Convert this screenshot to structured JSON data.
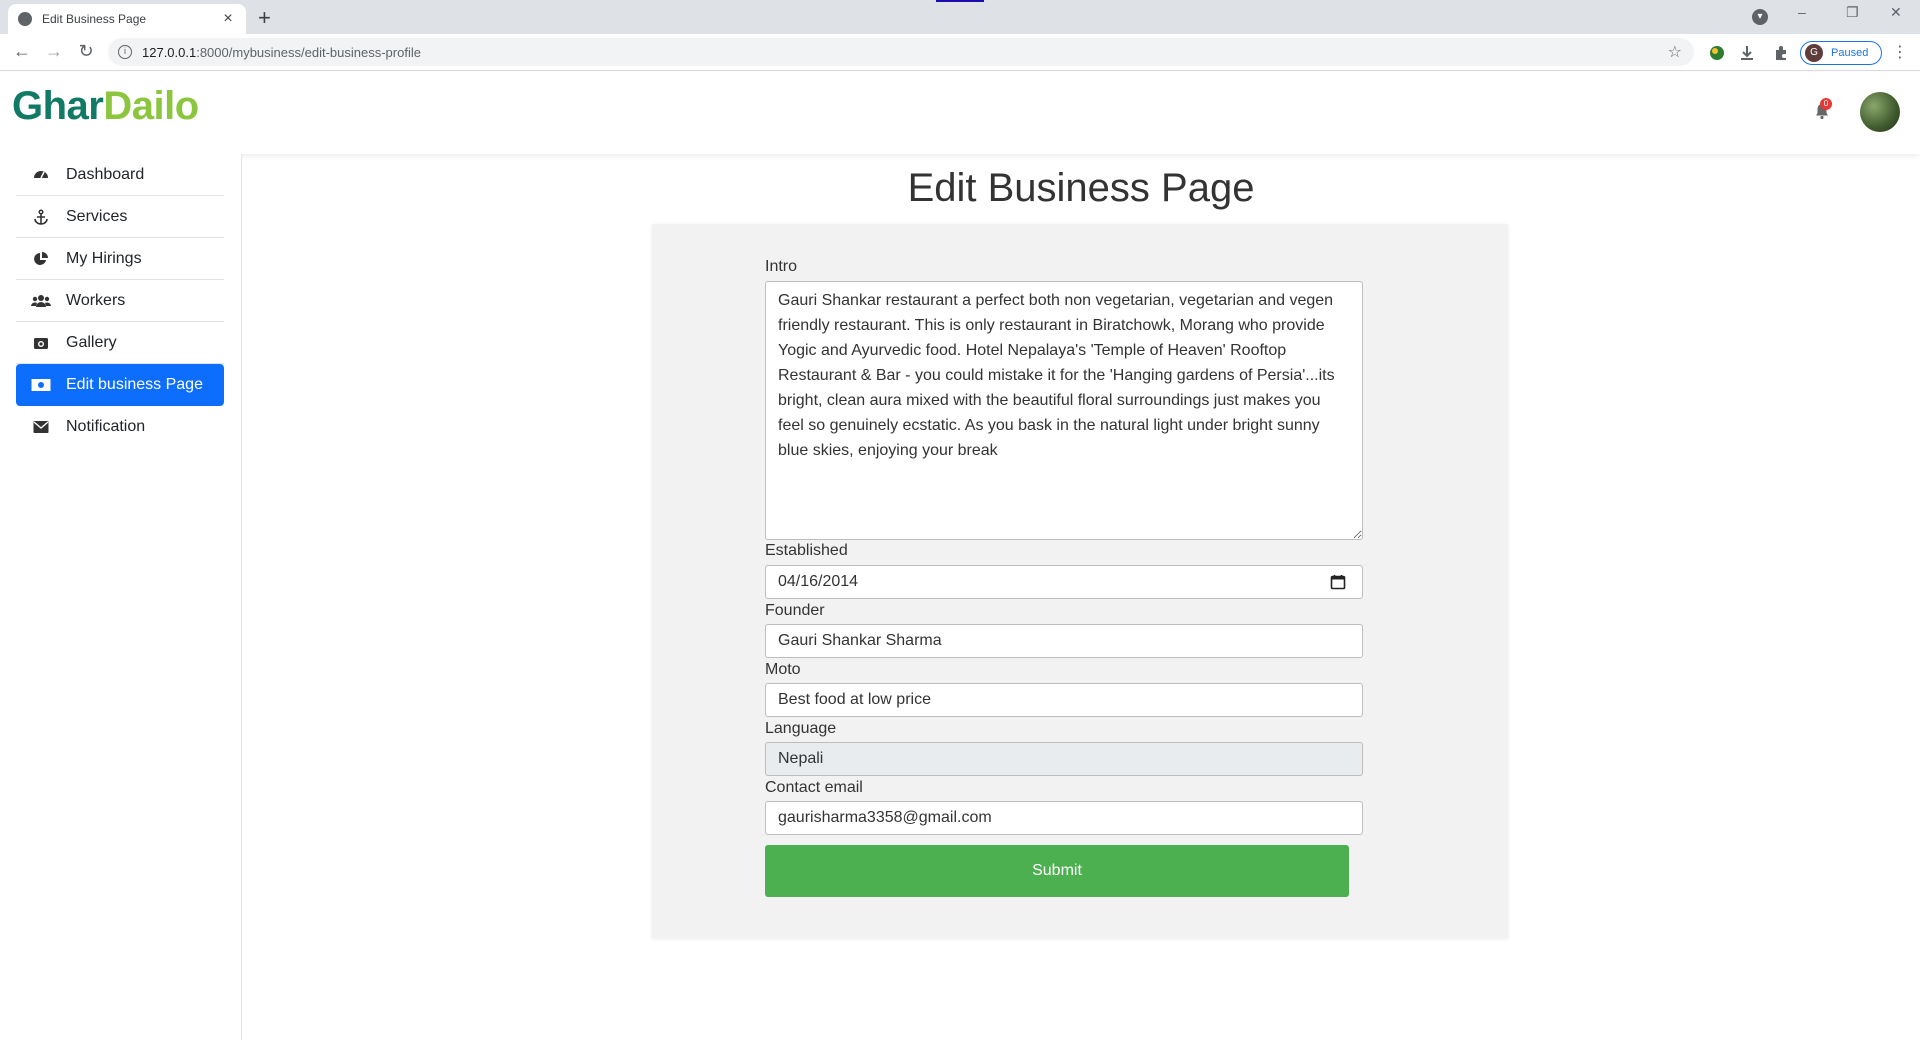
{
  "browser": {
    "tab_title": "Edit Business Page",
    "tab_close": "×",
    "new_tab": "+",
    "url_host": "127.0.0.1",
    "url_rest": ":8000/mybusiness/edit-business-profile",
    "profile_initial": "G",
    "profile_status": "Paused",
    "window_minimize": "–",
    "window_restore": "❐",
    "window_close": "✕"
  },
  "header": {
    "logo_part1": "Ghar",
    "logo_part2": "Dailo",
    "notification_count": "0"
  },
  "sidebar": {
    "items": [
      {
        "label": "Dashboard",
        "icon": "dashboard-icon"
      },
      {
        "label": "Services",
        "icon": "anchor-icon"
      },
      {
        "label": "My Hirings",
        "icon": "pie-chart-icon"
      },
      {
        "label": "Workers",
        "icon": "users-icon"
      },
      {
        "label": "Gallery",
        "icon": "camera-icon"
      },
      {
        "label": "Edit business Page",
        "icon": "money-bill-icon",
        "active": true
      },
      {
        "label": "Notification",
        "icon": "envelope-icon"
      }
    ]
  },
  "main": {
    "title": "Edit Business Page",
    "form": {
      "intro_label": "Intro",
      "intro_value": "Gauri Shankar restaurant a perfect both non vegetarian, vegetarian and vegen friendly restaurant. This is only restaurant in Biratchowk, Morang who provide Yogic and Ayurvedic food. Hotel Nepalaya's 'Temple of Heaven' Rooftop Restaurant & Bar - you could mistake it for the 'Hanging gardens of Persia'...its bright, clean aura mixed with the beautiful floral surroundings just makes you feel so genuinely ecstatic. As you bask in the natural light under bright sunny blue skies, enjoying your break",
      "established_label": "Established",
      "established_value": "04/16/2014",
      "founder_label": "Founder",
      "founder_value": "Gauri Shankar Sharma",
      "moto_label": "Moto",
      "moto_value": "Best food at low price",
      "language_label": "Language",
      "language_value": "Nepali",
      "email_label": "Contact email",
      "email_value": "gaurisharma3358@gmail.com",
      "submit_label": "Submit"
    }
  },
  "colors": {
    "logo_primary": "#117a65",
    "logo_secondary": "#8cc63f",
    "active_item": "#0d6efd",
    "submit": "#4caf50",
    "panel": "#f2f2f2"
  }
}
